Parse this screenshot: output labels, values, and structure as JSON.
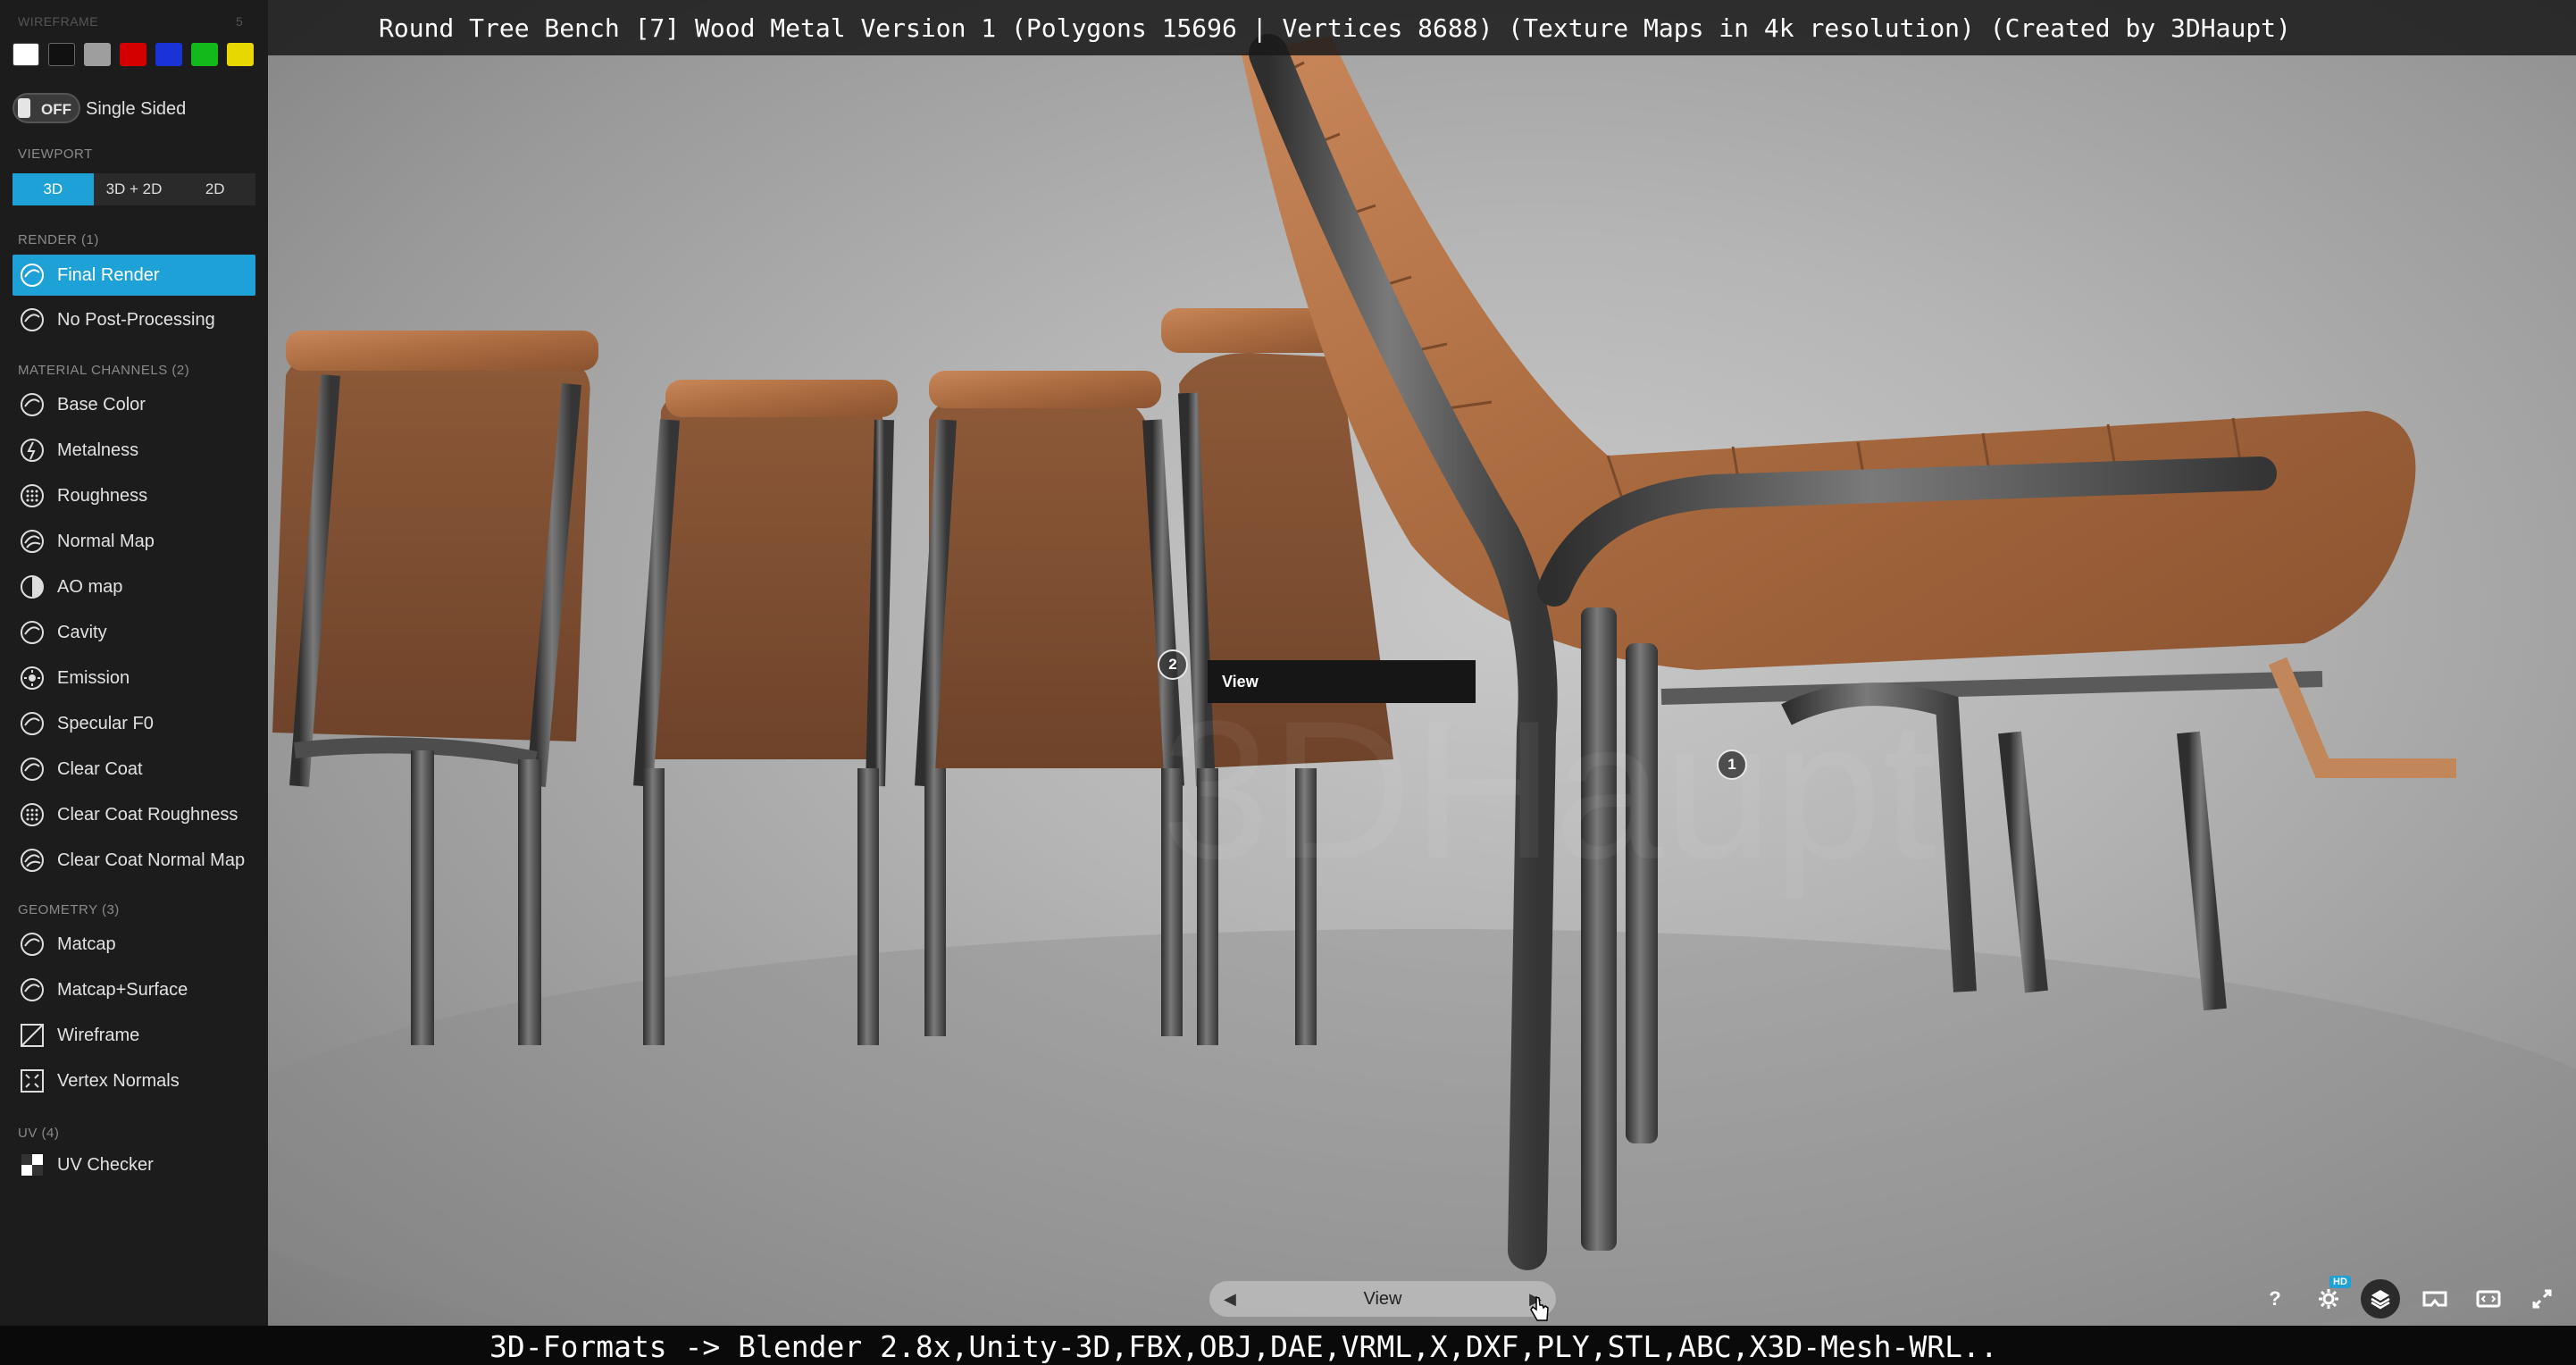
{
  "title": "Round Tree Bench [7] Wood Metal Version 1 (Polygons 15696 | Vertices 8688) (Texture Maps in 4k resolution) (Created by 3DHaupt)",
  "bottom_banner": "3D-Formats -> Blender 2.8x,Unity-3D,FBX,OBJ,DAE,VRML,X,DXF,PLY,STL,ABC,X3D-Mesh-WRL..",
  "sidebar": {
    "wireframe": {
      "label": "WIREFRAME",
      "count": "5",
      "swatches": [
        "#ffffff",
        "#111111",
        "#9e9e9e",
        "#d40000",
        "#1a33d6",
        "#13b81a",
        "#e6d800"
      ]
    },
    "single_sided": {
      "state": "OFF",
      "label": "Single Sided"
    },
    "viewport": {
      "label": "VIEWPORT",
      "options": [
        {
          "label": "3D",
          "active": true
        },
        {
          "label": "3D + 2D",
          "active": false
        },
        {
          "label": "2D",
          "active": false
        }
      ]
    },
    "render": {
      "label": "RENDER (1)",
      "items": [
        {
          "label": "Final Render",
          "icon": "final-render-icon",
          "active": true
        },
        {
          "label": "No Post-Processing",
          "icon": "no-post-processing-icon",
          "active": false
        }
      ]
    },
    "material_channels": {
      "label": "MATERIAL CHANNELS (2)",
      "items": [
        {
          "label": "Base Color",
          "icon": "base-color-icon"
        },
        {
          "label": "Metalness",
          "icon": "metalness-icon"
        },
        {
          "label": "Roughness",
          "icon": "roughness-icon"
        },
        {
          "label": "Normal Map",
          "icon": "normal-map-icon"
        },
        {
          "label": "AO map",
          "icon": "ao-map-icon"
        },
        {
          "label": "Cavity",
          "icon": "cavity-icon"
        },
        {
          "label": "Emission",
          "icon": "emission-icon"
        },
        {
          "label": "Specular F0",
          "icon": "specular-icon"
        },
        {
          "label": "Clear Coat",
          "icon": "clear-coat-icon"
        },
        {
          "label": "Clear Coat Roughness",
          "icon": "clear-coat-roughness-icon"
        },
        {
          "label": "Clear Coat Normal Map",
          "icon": "clear-coat-normal-icon"
        }
      ]
    },
    "geometry": {
      "label": "GEOMETRY (3)",
      "items": [
        {
          "label": "Matcap",
          "icon": "matcap-icon"
        },
        {
          "label": "Matcap+Surface",
          "icon": "matcap-surface-icon"
        },
        {
          "label": "Wireframe",
          "icon": "wireframe-icon"
        },
        {
          "label": "Vertex Normals",
          "icon": "vertex-normals-icon"
        }
      ]
    },
    "uv": {
      "label": "UV (4)",
      "items": [
        {
          "label": "UV Checker",
          "icon": "uv-checker-icon"
        }
      ]
    }
  },
  "annotations": [
    {
      "number": "2",
      "tooltip": "View"
    },
    {
      "number": "1"
    }
  ],
  "nav": {
    "label": "View",
    "prev_icon": "chevron-left-icon",
    "next_icon": "chevron-right-icon"
  },
  "toolbar": {
    "help": "?",
    "hd_badge": "HD",
    "icons": [
      "help-icon",
      "settings-icon",
      "layers-icon",
      "vr-icon",
      "embed-icon",
      "fullscreen-icon"
    ]
  },
  "colors": {
    "accent": "#1ea1d6",
    "sidebar_bg": "#1c1c1c",
    "wood": "#b8734a",
    "metal": "#4a4a4a"
  }
}
